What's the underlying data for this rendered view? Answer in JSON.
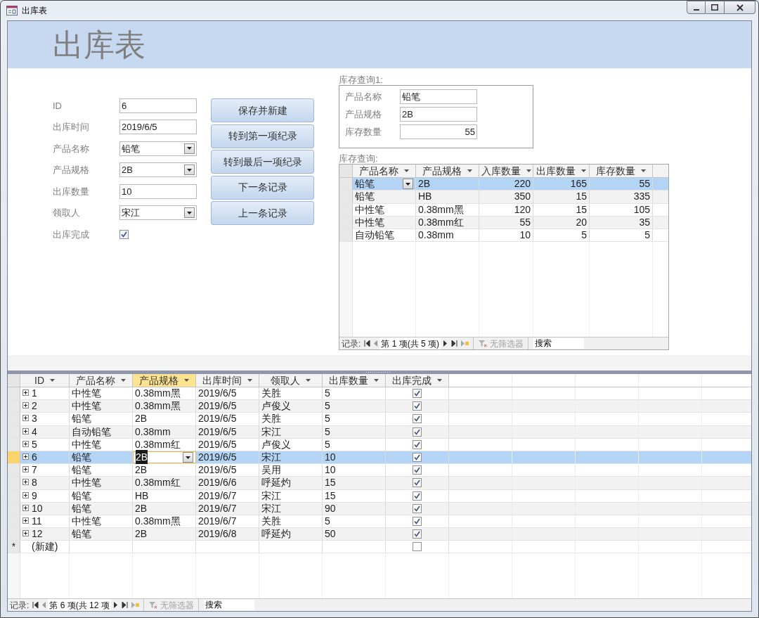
{
  "window": {
    "title": "出库表"
  },
  "form": {
    "title": "出库表",
    "fields": [
      {
        "label": "ID",
        "kind": "text",
        "value": "6"
      },
      {
        "label": "出库时间",
        "kind": "text",
        "value": "2019/6/5"
      },
      {
        "label": "产品名称",
        "kind": "combo",
        "value": "铅笔"
      },
      {
        "label": "产品规格",
        "kind": "combo",
        "value": "2B"
      },
      {
        "label": "出库数量",
        "kind": "text",
        "value": "10"
      },
      {
        "label": "领取人",
        "kind": "combo",
        "value": "宋江"
      },
      {
        "label": "出库完成",
        "kind": "checkbox",
        "checked": true
      }
    ],
    "buttons": [
      "保存并新建",
      "转到第一项纪录",
      "转到最后一项纪录",
      "下一条记录",
      "上一条记录"
    ]
  },
  "stock_query_1": {
    "label": "库存查询1:",
    "fields": [
      {
        "label": "产品名称",
        "kind": "text",
        "value": "铅笔"
      },
      {
        "label": "产品规格",
        "kind": "text",
        "value": "2B"
      },
      {
        "label": "库存数量",
        "kind": "number",
        "value": "55"
      }
    ]
  },
  "stock_query": {
    "label": "库存查询:",
    "columns": [
      {
        "label": "产品名称",
        "kind": "text",
        "selected": false,
        "focused": true
      },
      {
        "label": "产品规格",
        "kind": "text",
        "selected": false,
        "focused": false
      },
      {
        "label": "入库数量",
        "kind": "number",
        "selected": false,
        "focused": false
      },
      {
        "label": "出库数量",
        "kind": "number",
        "selected": false,
        "focused": false
      },
      {
        "label": "库存数量",
        "kind": "number",
        "selected": false,
        "focused": false
      }
    ],
    "rows": [
      {
        "cells": [
          "铅笔",
          "2B",
          "220",
          "165",
          "55"
        ],
        "selected": true
      },
      {
        "cells": [
          "铅笔",
          "HB",
          "350",
          "15",
          "335"
        ],
        "selected": false
      },
      {
        "cells": [
          "中性笔",
          "0.38mm黑",
          "120",
          "15",
          "105"
        ],
        "selected": false
      },
      {
        "cells": [
          "中性笔",
          "0.38mm红",
          "55",
          "20",
          "35"
        ],
        "selected": false
      },
      {
        "cells": [
          "自动铅笔",
          "0.38mm",
          "10",
          "5",
          "5"
        ],
        "selected": false
      }
    ],
    "nav": {
      "label": "记录:",
      "position": "第 1 项(共 5 项)",
      "filter": "无筛选器",
      "search": "搜索"
    }
  },
  "datasheet": {
    "columns": [
      {
        "label": "ID",
        "kind": "id",
        "selected": false,
        "focused": false
      },
      {
        "label": "产品名称",
        "kind": "text",
        "selected": false,
        "focused": false
      },
      {
        "label": "产品规格",
        "kind": "text",
        "selected": true,
        "focused": true
      },
      {
        "label": "出库时间",
        "kind": "text",
        "selected": false,
        "focused": false
      },
      {
        "label": "领取人",
        "kind": "text",
        "selected": false,
        "focused": false
      },
      {
        "label": "出库数量",
        "kind": "text",
        "selected": false,
        "focused": false
      },
      {
        "label": "出库完成",
        "kind": "checkbox",
        "selected": false,
        "focused": false
      }
    ],
    "rows": [
      {
        "cells": [
          "1",
          "中性笔",
          "0.38mm黑",
          "2019/6/5",
          "关胜",
          "5"
        ],
        "done": true,
        "selected": false
      },
      {
        "cells": [
          "2",
          "中性笔",
          "0.38mm黑",
          "2019/6/5",
          "卢俊义",
          "5"
        ],
        "done": true,
        "selected": false
      },
      {
        "cells": [
          "3",
          "铅笔",
          "2B",
          "2019/6/5",
          "关胜",
          "5"
        ],
        "done": true,
        "selected": false
      },
      {
        "cells": [
          "4",
          "自动铅笔",
          "0.38mm",
          "2019/6/5",
          "宋江",
          "5"
        ],
        "done": true,
        "selected": false
      },
      {
        "cells": [
          "5",
          "中性笔",
          "0.38mm红",
          "2019/6/5",
          "卢俊义",
          "5"
        ],
        "done": true,
        "selected": false
      },
      {
        "cells": [
          "6",
          "铅笔",
          "2B",
          "2019/6/5",
          "宋江",
          "10"
        ],
        "done": true,
        "selected": true
      },
      {
        "cells": [
          "7",
          "铅笔",
          "2B",
          "2019/6/5",
          "吴用",
          "10"
        ],
        "done": true,
        "selected": false
      },
      {
        "cells": [
          "8",
          "中性笔",
          "0.38mm红",
          "2019/6/6",
          "呼延灼",
          "15"
        ],
        "done": true,
        "selected": false
      },
      {
        "cells": [
          "9",
          "铅笔",
          "HB",
          "2019/6/7",
          "宋江",
          "15"
        ],
        "done": true,
        "selected": false
      },
      {
        "cells": [
          "10",
          "铅笔",
          "2B",
          "2019/6/7",
          "宋江",
          "90"
        ],
        "done": true,
        "selected": false
      },
      {
        "cells": [
          "11",
          "中性笔",
          "0.38mm黑",
          "2019/6/7",
          "关胜",
          "5"
        ],
        "done": true,
        "selected": false
      },
      {
        "cells": [
          "12",
          "铅笔",
          "2B",
          "2019/6/8",
          "呼延灼",
          "50"
        ],
        "done": true,
        "selected": false
      }
    ],
    "new_row": {
      "marker": "*",
      "label": "(新建)",
      "done": false
    },
    "nav": {
      "label": "记录:",
      "position": "第 6 项(共 12 项",
      "filter": "无筛选器",
      "search": "搜索"
    }
  }
}
